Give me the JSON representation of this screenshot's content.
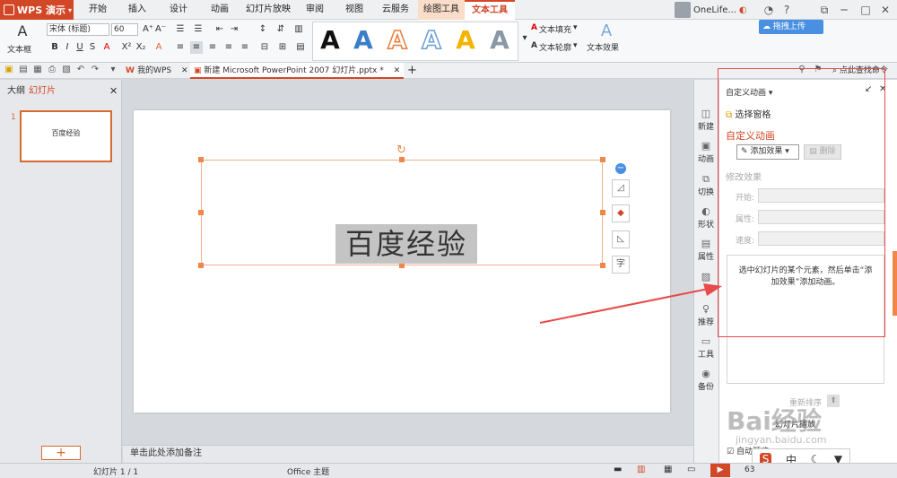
{
  "app": {
    "name": "WPS 演示"
  },
  "menu_tabs": [
    "开始",
    "插入",
    "设计",
    "动画",
    "幻灯片放映",
    "审阅",
    "视图",
    "云服务",
    "绘图工具",
    "文本工具"
  ],
  "user": {
    "name": "OneLife...",
    "sync_label": "拖拽上传"
  },
  "ribbon": {
    "textbox_label": "文本框",
    "font_name": "宋体 (标题)",
    "font_size": "60",
    "text_fill": "文本填充",
    "text_outline": "文本轮廓",
    "text_effect": "文本效果",
    "wordart_glyph": "A"
  },
  "tabs_bar": {
    "my_wps": "我的WPS",
    "document": "新建 Microsoft PowerPoint 2007 幻灯片.pptx *",
    "add": "+",
    "search": "点此查找命令"
  },
  "left_panel": {
    "tab_outline": "大纲",
    "tab_slides": "幻灯片",
    "slide_number": "1",
    "thumb_text": "百度经验"
  },
  "slide": {
    "text": "百度经验"
  },
  "notes": {
    "placeholder": "单击此处添加备注"
  },
  "sidebar": [
    {
      "label": "新建",
      "icon": "new-icon"
    },
    {
      "label": "动画",
      "icon": "animation-icon"
    },
    {
      "label": "切换",
      "icon": "transition-icon"
    },
    {
      "label": "形状",
      "icon": "shape-icon"
    },
    {
      "label": "属性",
      "icon": "property-icon"
    },
    {
      "label": "",
      "icon": "picture-icon"
    },
    {
      "label": "推荐",
      "icon": "recommend-icon"
    },
    {
      "label": "工具",
      "icon": "tool-icon"
    },
    {
      "label": "备份",
      "icon": "backup-icon"
    }
  ],
  "task_pane": {
    "header": "自定义动画",
    "select_pane": "选择窗格",
    "section_title": "自定义动画",
    "add_effect": "添加效果",
    "delete": "删除",
    "modify_title": "修改效果",
    "start": "开始:",
    "property": "属性:",
    "speed": "速度:",
    "hint": "选中幻灯片的某个元素，然后单击“添加效果”添加动画。",
    "reorder": "重新排序",
    "slideshow": "幻灯片播放",
    "autopreview": "自动预览"
  },
  "status_bar": {
    "slide_count": "幻灯片 1 / 1",
    "theme": "Office 主题",
    "zoom": "63"
  },
  "watermark": {
    "text": "Bai经验",
    "url": "jingyan.baidu.com"
  },
  "ime_bar": [
    "S",
    "中",
    "☾",
    "▼"
  ],
  "colors": {
    "accent": "#d24726",
    "arrow": "#e84b4b",
    "sync": "#4a90e2"
  }
}
